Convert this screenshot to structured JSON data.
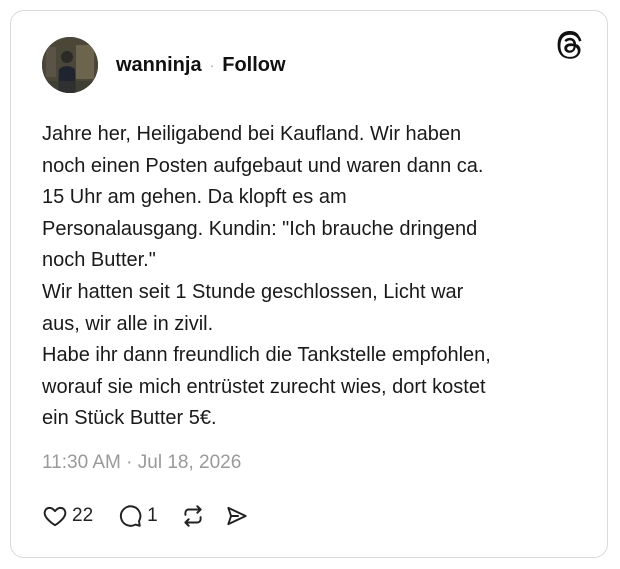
{
  "post": {
    "author": "wanninja",
    "separator": "·",
    "follow_label": "Follow",
    "text": "Jahre her, Heiligabend bei Kaufland. Wir haben\nnoch einen Posten aufgebaut und waren dann ca.\n15 Uhr am gehen. Da klopft es am\nPersonalausgang. Kundin: \"Ich brauche dringend\nnoch Butter.\"\nWir hatten seit 1 Stunde geschlossen, Licht war\naus, wir alle in zivil.\nHabe ihr dann freundlich die Tankstelle empfohlen,\nworauf sie mich entrüstet zurecht wies, dort kostet\nein Stück Butter 5€.",
    "timestamp": "11:30 AM · Jul 18, 2026",
    "likes": "22",
    "replies": "1"
  },
  "icons": {
    "logo": "threads-logo-icon",
    "like": "heart-icon",
    "reply": "comment-bubble-icon",
    "repost": "repost-icon",
    "share": "send-icon"
  }
}
